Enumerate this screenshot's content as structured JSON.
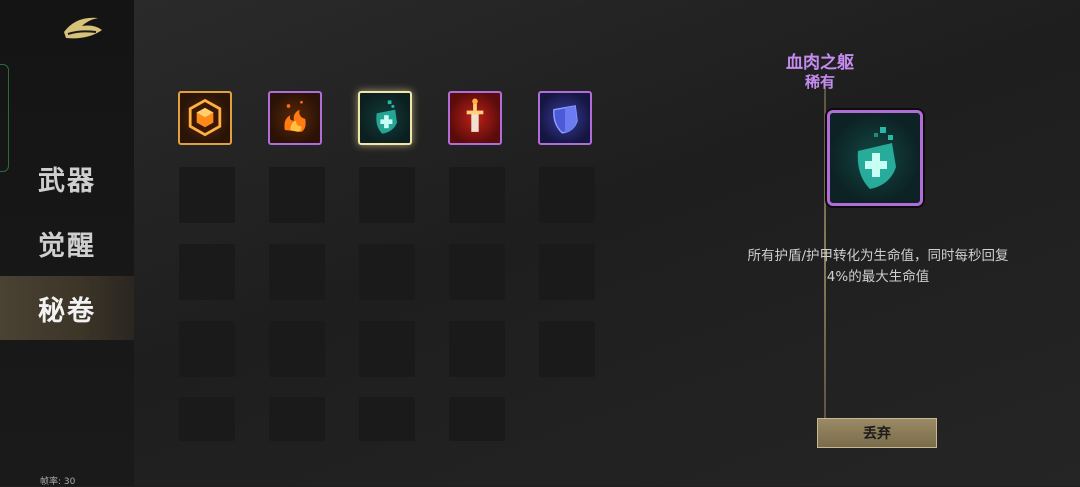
{
  "sidebar": {
    "items": [
      {
        "label": "武器",
        "active": false
      },
      {
        "label": "觉醒",
        "active": false
      },
      {
        "label": "秘卷",
        "active": true
      }
    ],
    "fps_label": "帧率: 30"
  },
  "inventory": {
    "items": [
      {
        "name": "orange-hexagon-gem",
        "rarity_color": "#e0a040"
      },
      {
        "name": "fire-fist",
        "rarity_color": "#b06cd8"
      },
      {
        "name": "teal-cross-shield",
        "rarity_color": "#f0e6a8",
        "selected": true
      },
      {
        "name": "red-sword",
        "rarity_color": "#b06cd8"
      },
      {
        "name": "blue-shield",
        "rarity_color": "#b06cd8"
      }
    ],
    "empty_slot_count": 19
  },
  "detail": {
    "name": "血肉之躯",
    "rarity": "稀有",
    "description": "所有护盾/护甲转化为生命值，同时每秒回复4%的最大生命值",
    "discard_label": "丢弃"
  },
  "colors": {
    "rare_purple": "#c58cf0",
    "gold_button": "#8a7a58"
  }
}
